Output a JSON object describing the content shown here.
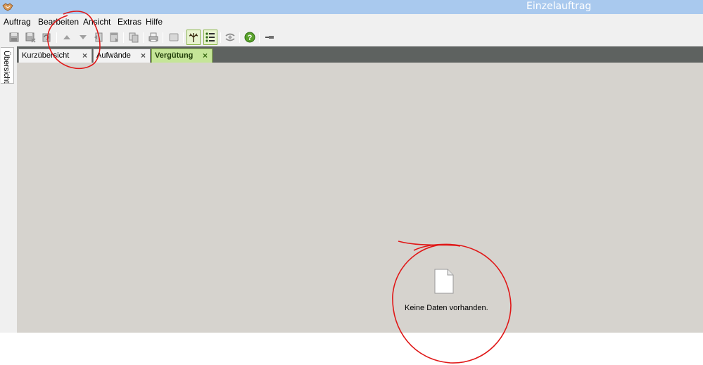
{
  "window": {
    "title": "Einzelauftrag"
  },
  "menu": {
    "items": [
      "Auftrag",
      "Bearbeiten",
      "Ansicht",
      "Extras",
      "Hilfe"
    ]
  },
  "toolbar": {
    "buttons": [
      {
        "icon": "save-icon"
      },
      {
        "icon": "save-close-icon"
      },
      {
        "icon": "undo-icon"
      },
      {
        "icon": "arrow-up-icon"
      },
      {
        "icon": "arrow-down-icon"
      },
      {
        "icon": "document-first-icon"
      },
      {
        "icon": "document-last-icon"
      },
      {
        "icon": "copy-document-icon"
      },
      {
        "icon": "print-icon"
      },
      {
        "icon": "blank-icon"
      },
      {
        "icon": "tree-view-icon",
        "active": true
      },
      {
        "icon": "list-view-icon",
        "active": true
      },
      {
        "icon": "refresh-icon"
      },
      {
        "icon": "help-icon"
      },
      {
        "icon": "pin-icon"
      }
    ]
  },
  "sidebar": {
    "tab_label": "Übersicht"
  },
  "tabs": [
    {
      "label": "Kurzübersicht",
      "close": "×",
      "active": false
    },
    {
      "label": "Aufwände",
      "close": "×",
      "active": false
    },
    {
      "label": "Vergütung",
      "close": "×",
      "active": true
    }
  ],
  "content": {
    "empty_message": "Keine Daten vorhanden.",
    "empty_icon": "document-icon"
  },
  "colors": {
    "titlebar": "#a9c9ee",
    "active_tab": "#c5e598",
    "tabstrip": "#5e6260",
    "content_bg": "#d6d3ce",
    "annotation": "#e01818"
  }
}
